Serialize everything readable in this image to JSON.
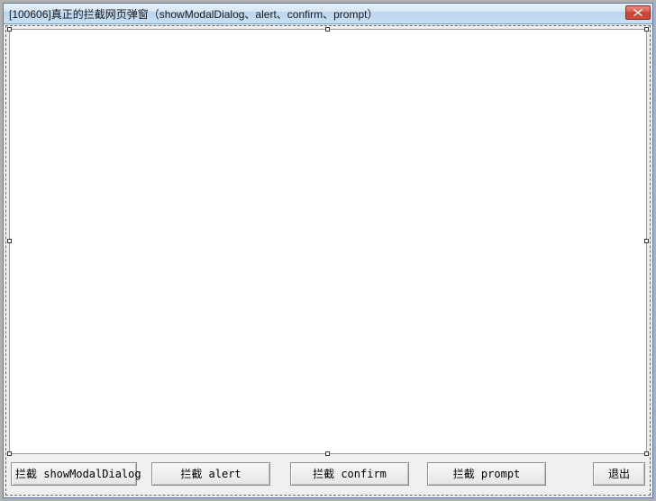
{
  "window": {
    "title": "[100606]真正的拦截网页弹窗（showModalDialog、alert、confirm、prompt）"
  },
  "buttons": {
    "block_showModalDialog": "拦截 showModalDialog",
    "block_alert": "拦截 alert",
    "block_confirm": "拦截 confirm",
    "block_prompt": "拦截 prompt",
    "exit": "退出"
  }
}
